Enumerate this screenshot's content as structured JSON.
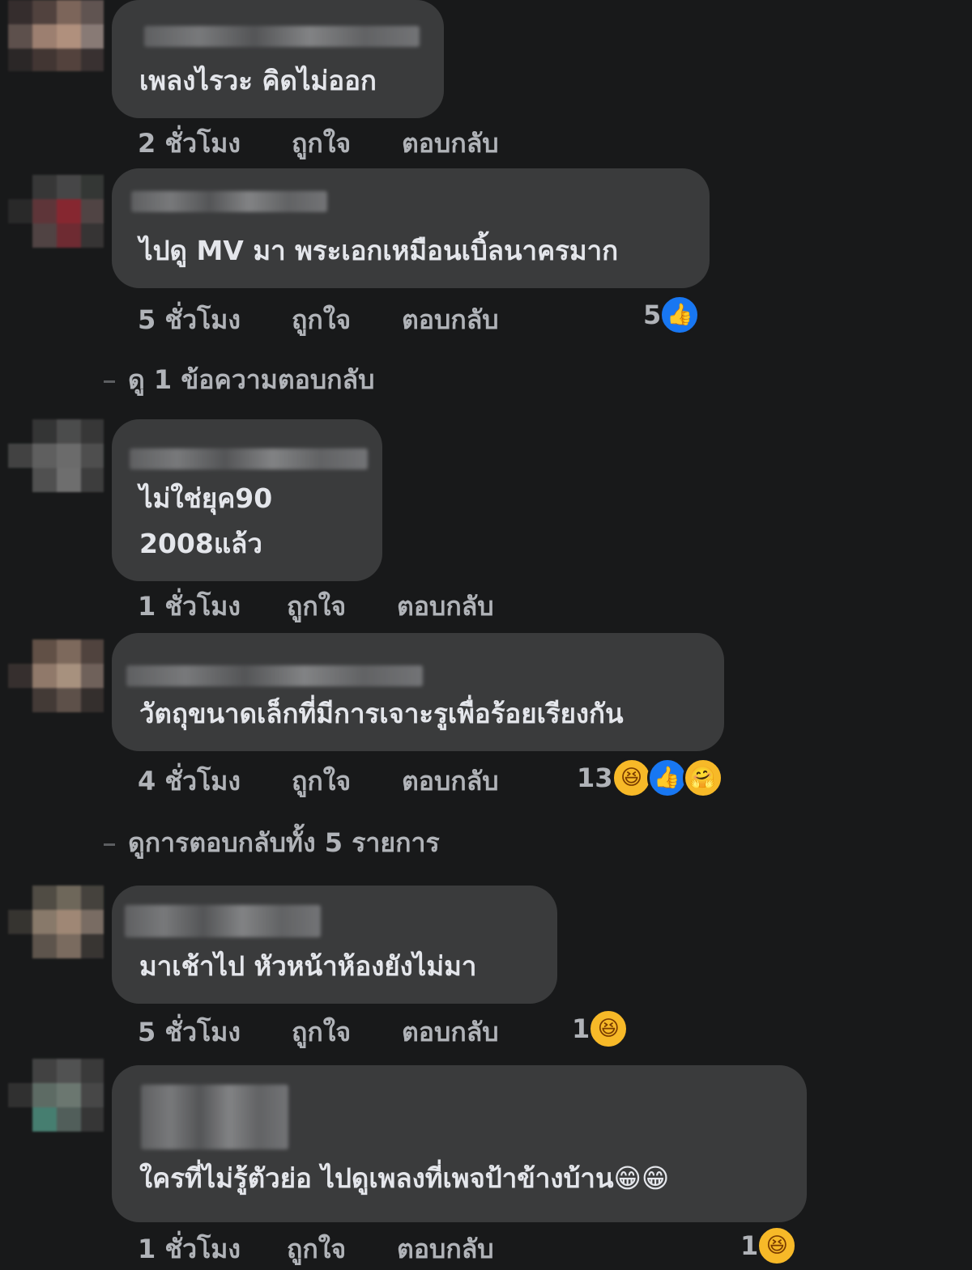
{
  "actions": {
    "like": "ถูกใจ",
    "reply": "ตอบกลับ"
  },
  "colors": {
    "background": "#18191a",
    "bubble": "#3a3b3c",
    "like_blue": "#1877f2",
    "haha_yellow": "#f7b928"
  },
  "comments": [
    {
      "text_lines": [
        "เพลงไรวะ คิดไม่ออก"
      ],
      "time": "2 ชั่วโมง",
      "reaction_count": "",
      "reactions": []
    },
    {
      "text_lines": [
        "ไปดู MV มา พระเอกเหมือนเบิ้ลนาครมาก"
      ],
      "time": "5 ชั่วโมง",
      "reaction_count": "5",
      "reactions": [
        "like-icon"
      ]
    },
    {
      "text_lines": [
        "ไม่ใช่ยุค90",
        "2008แล้ว"
      ],
      "time": "1 ชั่วโมง",
      "reaction_count": "",
      "reactions": []
    },
    {
      "text_lines": [
        "วัตถุขนาดเล็กที่มีการเจาะรูเพื่อร้อยเรียงกัน"
      ],
      "time": "4 ชั่วโมง",
      "reaction_count": "13",
      "reactions": [
        "haha-icon",
        "like-icon",
        "care-icon"
      ]
    },
    {
      "text_lines": [
        "มาเช้าไป หัวหน้าห้องยังไม่มา"
      ],
      "time": "5 ชั่วโมง",
      "reaction_count": "1",
      "reactions": [
        "haha-icon"
      ]
    },
    {
      "text_lines": [
        "ใครที่ไม่รู้ตัวย่อ ไปดูเพลงที่เพจป้าข้างบ้าน😁😁"
      ],
      "time": "1 ชั่วโมง",
      "reaction_count": "1",
      "reactions": [
        "haha-icon"
      ]
    }
  ],
  "view_replies": [
    "ดู 1 ข้อความตอบกลับ",
    "ดูการตอบกลับทั้ง 5 รายการ"
  ]
}
